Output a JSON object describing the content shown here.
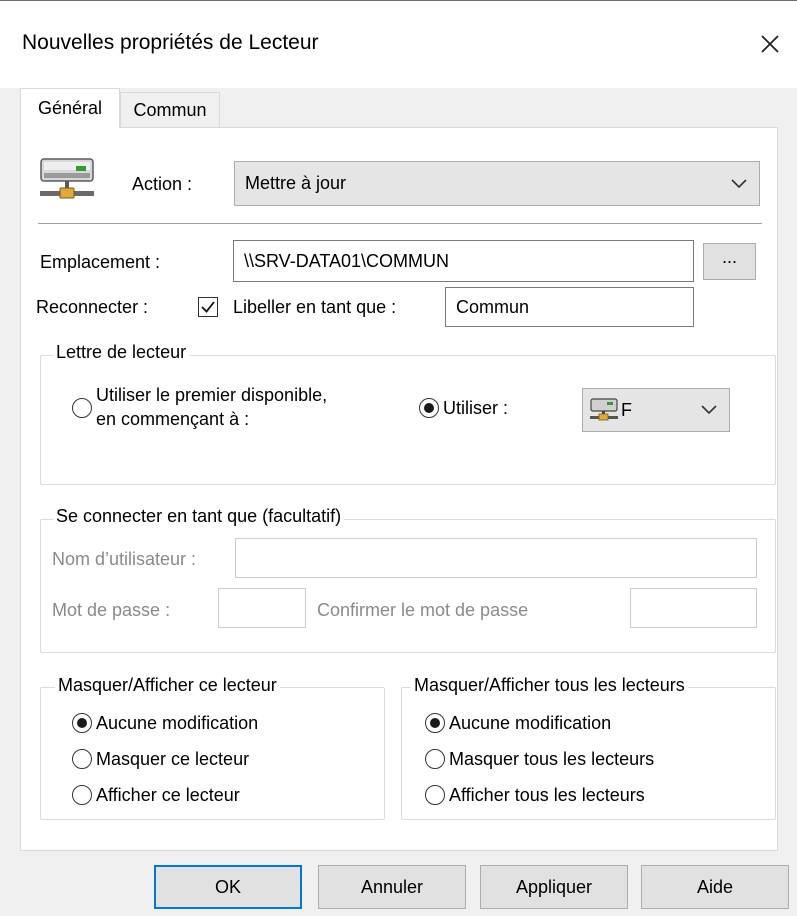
{
  "window": {
    "title": "Nouvelles propriétés de Lecteur",
    "close_icon": "close-icon"
  },
  "tabs": [
    {
      "label": "Général",
      "active": true
    },
    {
      "label": "Commun",
      "active": false
    }
  ],
  "action": {
    "label": "Action :",
    "value": "Mettre à jour",
    "icon": "network-drive-icon"
  },
  "location": {
    "label": "Emplacement :",
    "value": "\\\\SRV-DATA01\\COMMUN",
    "browse_label": "..."
  },
  "reconnect": {
    "label": "Reconnecter :",
    "checked": true,
    "label_as": "Libeller en tant que :",
    "label_value": "Commun"
  },
  "drive_letter": {
    "group_title": "Lettre de lecteur",
    "first_available_line1": "Utiliser le premier disponible,",
    "first_available_line2": "en commençant à :",
    "use_label": "Utiliser :",
    "selected_letter": "F",
    "selected_option": "use"
  },
  "connect_as": {
    "group_title": "Se connecter en tant que (facultatif)",
    "username_label": "Nom d’utilisateur :",
    "username_value": "",
    "password_label": "Mot de passe :",
    "confirm_label": "Confirmer le mot de passe"
  },
  "hide_this": {
    "group_title": "Masquer/Afficher ce lecteur",
    "options": [
      "Aucune modification",
      "Masquer ce lecteur",
      "Afficher ce lecteur"
    ],
    "selected": 0
  },
  "hide_all": {
    "group_title": "Masquer/Afficher tous les lecteurs",
    "options": [
      "Aucune modification",
      "Masquer tous les lecteurs",
      "Afficher tous les lecteurs"
    ],
    "selected": 0
  },
  "buttons": {
    "ok": "OK",
    "cancel": "Annuler",
    "apply": "Appliquer",
    "help": "Aide"
  },
  "colors": {
    "accent": "#0078d7",
    "drive_icon_green": "#2e9e2e"
  }
}
